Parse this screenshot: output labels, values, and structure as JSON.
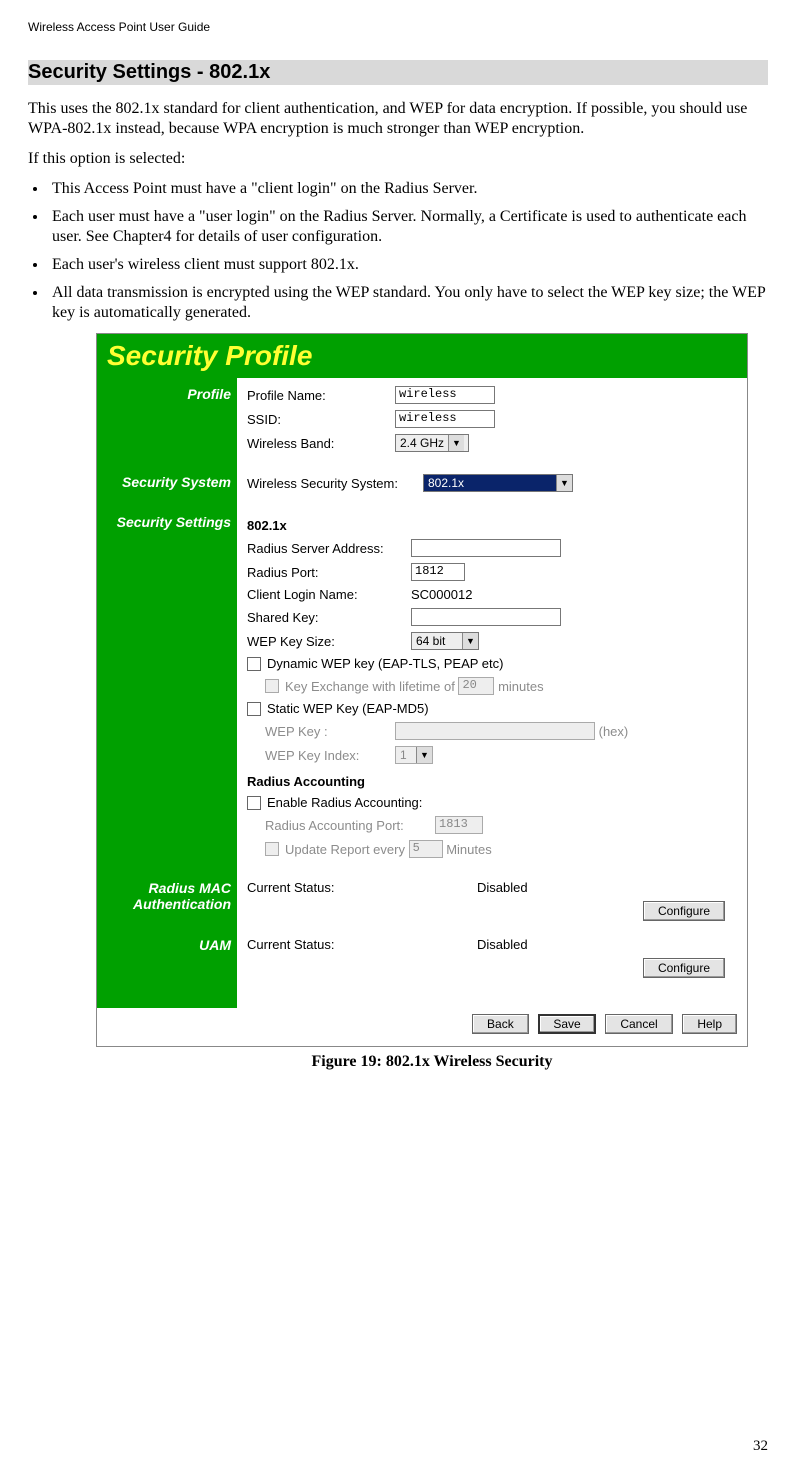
{
  "header": {
    "running_head": "Wireless Access Point User Guide"
  },
  "section": {
    "title": "Security Settings - 802.1x",
    "intro": "This uses the 802.1x standard for client authentication, and WEP for data encryption. If possible, you should use WPA-802.1x instead, because WPA encryption is much stronger than WEP encryption.",
    "lead": "If this option is selected:",
    "bullets": [
      "This Access Point must have a \"client login\" on the Radius Server.",
      "Each user must have a \"user login\" on the Radius Server. Normally, a Certificate is used to authenticate each user. See Chapter4 for details of user configuration.",
      "Each user's wireless client must support 802.1x.",
      "All data transmission is encrypted using the WEP standard. You only have to select the WEP key size; the WEP key is automatically generated."
    ]
  },
  "shot": {
    "title": "Security Profile",
    "sidebar": {
      "profile": "Profile",
      "sec_system": "Security System",
      "sec_settings": "Security Settings",
      "radius_mac": "Radius MAC Authentication",
      "uam": "UAM"
    },
    "profile": {
      "profile_name_label": "Profile Name:",
      "profile_name_value": "wireless",
      "ssid_label": "SSID:",
      "ssid_value": "wireless",
      "band_label": "Wireless Band:",
      "band_value": "2.4 GHz"
    },
    "sec_system": {
      "label": "Wireless Security System:",
      "value": "802.1x"
    },
    "settings": {
      "heading": "802.1x",
      "radius_addr_label": "Radius Server Address:",
      "radius_addr_value": "",
      "radius_port_label": "Radius Port:",
      "radius_port_value": "1812",
      "client_login_label": "Client Login Name:",
      "client_login_value": "SC000012",
      "shared_key_label": "Shared Key:",
      "shared_key_value": "",
      "wep_size_label": "WEP Key Size:",
      "wep_size_value": "64 bit",
      "dyn_wep_label": "Dynamic WEP key (EAP-TLS, PEAP etc)",
      "key_exchange_label_pre": "Key Exchange with lifetime of",
      "key_exchange_value": "20",
      "key_exchange_label_post": "minutes",
      "static_wep_label": "Static WEP Key (EAP-MD5)",
      "wep_key_label": "WEP Key :",
      "wep_key_value": "",
      "wep_key_hex": "(hex)",
      "wep_key_index_label": "WEP Key Index:",
      "wep_key_index_value": "1",
      "ra_heading": "Radius Accounting",
      "ra_enable_label": "Enable Radius Accounting:",
      "ra_port_label": "Radius Accounting Port:",
      "ra_port_value": "1813",
      "ra_update_pre": "Update Report every",
      "ra_update_value": "5",
      "ra_update_post": "Minutes"
    },
    "radius_mac": {
      "status_label": "Current Status:",
      "status_value": "Disabled",
      "configure": "Configure"
    },
    "uam": {
      "status_label": "Current Status:",
      "status_value": "Disabled",
      "configure": "Configure"
    },
    "buttons": {
      "back": "Back",
      "save": "Save",
      "cancel": "Cancel",
      "help": "Help"
    }
  },
  "figure_caption": "Figure 19: 802.1x Wireless Security",
  "page_number": "32"
}
